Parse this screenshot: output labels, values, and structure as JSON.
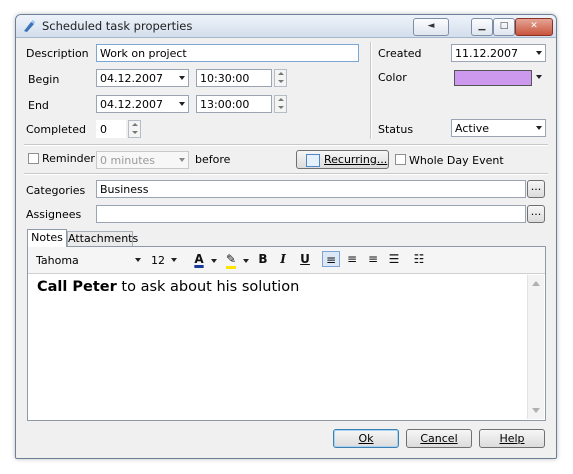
{
  "window": {
    "title": "Scheduled task properties",
    "tab_arrow": "◄"
  },
  "form": {
    "description_label": "Description",
    "description_value": "Work on project",
    "begin_label": "Begin",
    "begin_date": "04.12.2007",
    "begin_time": "10:30:00",
    "end_label": "End",
    "end_date": "04.12.2007",
    "end_time": "13:00:00",
    "completed_label": "Completed",
    "completed_value": "0",
    "created_label": "Created",
    "created_value": "11.12.2007",
    "color_label": "Color",
    "color_value": "#cc99ee",
    "status_label": "Status",
    "status_value": "Active",
    "reminder_label": "Reminder",
    "reminder_value": "0 minutes",
    "before_label": "before",
    "recurring_label": "Recurring...",
    "whole_day_label": "Whole Day Event",
    "categories_label": "Categories",
    "categories_value": "Business",
    "assignees_label": "Assignees",
    "assignees_value": "",
    "ellipsis": "..."
  },
  "tabs": [
    {
      "label": "Notes"
    },
    {
      "label": "Attachments"
    }
  ],
  "editor": {
    "font_name": "Tahoma",
    "font_size": "12",
    "bold_label": "B",
    "italic_label": "I",
    "underline_label": "U",
    "text_bold": "Call Peter",
    "text_rest": " to ask about his solution"
  },
  "buttons": {
    "ok": "Ok",
    "cancel": "Cancel",
    "help": "Help"
  }
}
